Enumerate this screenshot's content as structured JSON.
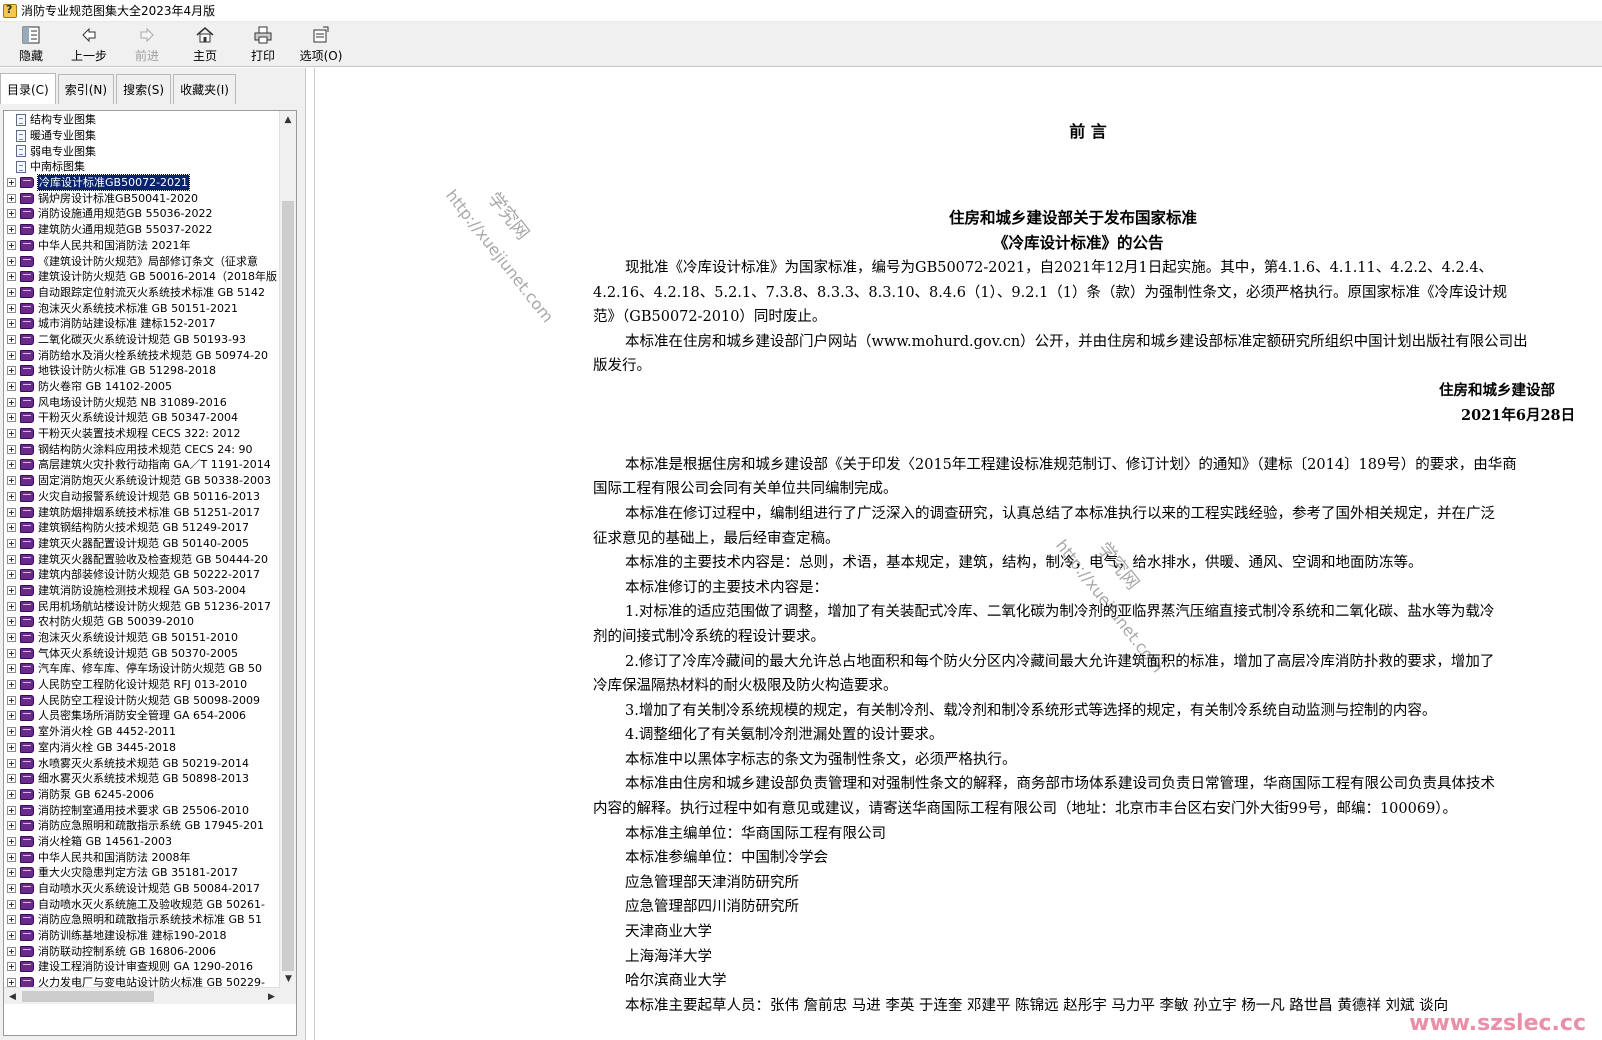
{
  "window": {
    "title": "消防专业规范图集大全2023年4月版"
  },
  "toolbar": {
    "buttons": [
      {
        "label": "隐藏",
        "icon": "hide-pane-icon",
        "enabled": true
      },
      {
        "label": "上一步",
        "icon": "back-arrow-icon",
        "enabled": true
      },
      {
        "label": "前进",
        "icon": "forward-arrow-icon",
        "enabled": false
      },
      {
        "label": "主页",
        "icon": "home-icon",
        "enabled": true
      },
      {
        "label": "打印",
        "icon": "printer-icon",
        "enabled": true
      },
      {
        "label": "选项(O)",
        "icon": "options-icon",
        "enabled": true
      }
    ]
  },
  "tabs": [
    {
      "label": "目录(C)",
      "active": true
    },
    {
      "label": "索引(N)",
      "active": false
    },
    {
      "label": "搜索(S)",
      "active": false
    },
    {
      "label": "收藏夹(I)",
      "active": false
    }
  ],
  "tree": {
    "items": [
      {
        "label": "结构专业图集",
        "type": "page"
      },
      {
        "label": "暖通专业图集",
        "type": "page"
      },
      {
        "label": "弱电专业图集",
        "type": "page"
      },
      {
        "label": "中南标图集",
        "type": "page"
      },
      {
        "label": "冷库设计标准GB50072-2021",
        "type": "book",
        "selected": true
      },
      {
        "label": "锅炉房设计标准GB50041-2020",
        "type": "book"
      },
      {
        "label": "消防设施通用规范GB 55036-2022",
        "type": "book"
      },
      {
        "label": "建筑防火通用规范GB 55037-2022",
        "type": "book"
      },
      {
        "label": "中华人民共和国消防法 2021年",
        "type": "book"
      },
      {
        "label": "《建筑设计防火规范》局部修订条文（征求意",
        "type": "book"
      },
      {
        "label": "建筑设计防火规范 GB 50016-2014（2018年版",
        "type": "book"
      },
      {
        "label": "自动跟踪定位射流灭火系统技术标准 GB 5142",
        "type": "book"
      },
      {
        "label": "泡沫灭火系统技术标准 GB 50151-2021",
        "type": "book"
      },
      {
        "label": "城市消防站建设标准 建标152-2017",
        "type": "book"
      },
      {
        "label": "二氧化碳灭火系统设计规范 GB 50193-93",
        "type": "book"
      },
      {
        "label": "消防给水及消火栓系统技术规范 GB 50974-20",
        "type": "book"
      },
      {
        "label": "地铁设计防火标准 GB 51298-2018",
        "type": "book"
      },
      {
        "label": "防火卷帘 GB 14102-2005",
        "type": "book"
      },
      {
        "label": "风电场设计防火规范 NB 31089-2016",
        "type": "book"
      },
      {
        "label": "干粉灭火系统设计规范 GB 50347-2004",
        "type": "book"
      },
      {
        "label": "干粉灭火装置技术规程 CECS 322: 2012",
        "type": "book"
      },
      {
        "label": "钢结构防火涂料应用技术规范 CECS 24: 90",
        "type": "book"
      },
      {
        "label": "高层建筑火灾扑救行动指南 GA／T 1191-2014",
        "type": "book"
      },
      {
        "label": "固定消防炮灭火系统设计规范 GB 50338-2003",
        "type": "book"
      },
      {
        "label": "火灾自动报警系统设计规范 GB 50116-2013",
        "type": "book"
      },
      {
        "label": "建筑防烟排烟系统技术标准 GB 51251-2017",
        "type": "book"
      },
      {
        "label": "建筑钢结构防火技术规范 GB 51249-2017",
        "type": "book"
      },
      {
        "label": "建筑灭火器配置设计规范 GB 50140-2005",
        "type": "book"
      },
      {
        "label": "建筑灭火器配置验收及检查规范 GB 50444-20",
        "type": "book"
      },
      {
        "label": "建筑内部装修设计防火规范 GB 50222-2017",
        "type": "book"
      },
      {
        "label": "建筑消防设施检测技术规程 GA 503-2004",
        "type": "book"
      },
      {
        "label": "民用机场航站楼设计防火规范 GB 51236-2017",
        "type": "book"
      },
      {
        "label": "农村防火规范 GB 50039-2010",
        "type": "book"
      },
      {
        "label": "泡沫灭火系统设计规范 GB 50151-2010",
        "type": "book"
      },
      {
        "label": "气体灭火系统设计规范 GB 50370-2005",
        "type": "book"
      },
      {
        "label": "汽车库、修车库、停车场设计防火规范 GB 50",
        "type": "book"
      },
      {
        "label": "人民防空工程防化设计规范 RFJ 013-2010",
        "type": "book"
      },
      {
        "label": "人民防空工程设计防火规范 GB 50098-2009",
        "type": "book"
      },
      {
        "label": "人员密集场所消防安全管理 GA 654-2006",
        "type": "book"
      },
      {
        "label": "室外消火栓 GB 4452-2011",
        "type": "book"
      },
      {
        "label": "室内消火栓 GB 3445-2018",
        "type": "book"
      },
      {
        "label": "水喷雾灭火系统技术规范 GB 50219-2014",
        "type": "book"
      },
      {
        "label": "细水雾灭火系统技术规范 GB 50898-2013",
        "type": "book"
      },
      {
        "label": "消防泵 GB 6245-2006",
        "type": "book"
      },
      {
        "label": "消防控制室通用技术要求 GB 25506-2010",
        "type": "book"
      },
      {
        "label": "消防应急照明和疏散指示系统 GB 17945-201",
        "type": "book"
      },
      {
        "label": "消火栓箱 GB 14561-2003",
        "type": "book"
      },
      {
        "label": "中华人民共和国消防法 2008年",
        "type": "book"
      },
      {
        "label": "重大火灾隐患判定方法 GB 35181-2017",
        "type": "book"
      },
      {
        "label": "自动喷水灭火系统设计规范 GB 50084-2017",
        "type": "book"
      },
      {
        "label": "自动喷水灭火系统施工及验收规范 GB 50261-",
        "type": "book"
      },
      {
        "label": "消防应急照明和疏散指示系统技术标准 GB 51",
        "type": "book"
      },
      {
        "label": "消防训练基地建设标准 建标190-2018",
        "type": "book"
      },
      {
        "label": "消防联动控制系统 GB 16806-2006",
        "type": "book"
      },
      {
        "label": "建设工程消防设计审查规则 GA 1290-2016",
        "type": "book"
      },
      {
        "label": "火力发电厂与变电站设计防火标准 GB 50229-",
        "type": "book"
      }
    ]
  },
  "document": {
    "preface_title": "前 言",
    "heading_line1": "住房和城乡建设部关于发布国家标准",
    "heading_line2": "《冷库设计标准》的公告",
    "lines": [
      {
        "text": "现批准《冷库设计标准》为国家标准，编号为GB50072-2021，自2021年12月1日起实施。其中，第4.1.6、4.1.11、4.2.2、4.2.4、",
        "style": "ind"
      },
      {
        "text": "4.2.16、4.2.18、5.2.1、7.3.8、8.3.3、8.3.10、8.4.6（1）、9.2.1（1）条（款）为强制性条文，必须严格执行。原国家标准《冷库设计规",
        "style": ""
      },
      {
        "text": "范》（GB50072-2010）同时废止。",
        "style": ""
      },
      {
        "text": "本标准在住房和城乡建设部门户网站（www.mohurd.gov.cn）公开，并由住房和城乡建设部标准定额研究所组织中国计划出版社有限公司出",
        "style": "ind"
      },
      {
        "text": "版发行。",
        "style": ""
      },
      {
        "text": "住房和城乡建设部",
        "style": "right"
      },
      {
        "text": "2021年6月28日",
        "style": "right2"
      },
      {
        "text": "",
        "style": "blank"
      },
      {
        "text": "本标准是根据住房和城乡建设部《关于印发〈2015年工程建设标准规范制订、修订计划〉的通知》（建标〔2014〕189号）的要求，由华商",
        "style": "ind"
      },
      {
        "text": "国际工程有限公司会同有关单位共同编制完成。",
        "style": ""
      },
      {
        "text": "本标准在修订过程中，编制组进行了广泛深入的调查研究，认真总结了本标准执行以来的工程实践经验，参考了国外相关规定，并在广泛",
        "style": "ind"
      },
      {
        "text": "征求意见的基础上，最后经审查定稿。",
        "style": ""
      },
      {
        "text": "本标准的主要技术内容是：总则，术语，基本规定，建筑，结构，制冷，电气，给水排水，供暖、通风、空调和地面防冻等。",
        "style": "ind"
      },
      {
        "text": "本标准修订的主要技术内容是：",
        "style": "ind"
      },
      {
        "text": "1.对标准的适应范围做了调整，增加了有关装配式冷库、二氧化碳为制冷剂的亚临界蒸汽压缩直接式制冷系统和二氧化碳、盐水等为载冷",
        "style": "ind"
      },
      {
        "text": "剂的间接式制冷系统的程设计要求。",
        "style": ""
      },
      {
        "text": "2.修订了冷库冷藏间的最大允许总占地面积和每个防火分区内冷藏间最大允许建筑面积的标准，增加了高层冷库消防扑救的要求，增加了",
        "style": "ind"
      },
      {
        "text": "冷库保温隔热材料的耐火极限及防火构造要求。",
        "style": ""
      },
      {
        "text": "3.增加了有关制冷系统规模的规定，有关制冷剂、载冷剂和制冷系统形式等选择的规定，有关制冷系统自动监测与控制的内容。",
        "style": "ind"
      },
      {
        "text": "4.调整细化了有关氨制冷剂泄漏处置的设计要求。",
        "style": "ind"
      },
      {
        "text": "本标准中以黑体字标志的条文为强制性条文，必须严格执行。",
        "style": "ind"
      },
      {
        "text": "本标准由住房和城乡建设部负责管理和对强制性条文的解释，商务部市场体系建设司负责日常管理，华商国际工程有限公司负责具体技术",
        "style": "ind"
      },
      {
        "text": "内容的解释。执行过程中如有意见或建议，请寄送华商国际工程有限公司（地址：北京市丰台区右安门外大街99号，邮编：100069）。",
        "style": ""
      },
      {
        "text": "本标准主编单位：华商国际工程有限公司",
        "style": "ind"
      },
      {
        "text": "本标准参编单位：中国制冷学会",
        "style": "ind"
      },
      {
        "text": "应急管理部天津消防研究所",
        "style": "ind"
      },
      {
        "text": "应急管理部四川消防研究所",
        "style": "ind"
      },
      {
        "text": "天津商业大学",
        "style": "ind"
      },
      {
        "text": "上海海洋大学",
        "style": "ind"
      },
      {
        "text": "哈尔滨商业大学",
        "style": "ind"
      },
      {
        "text": "本标准主要起草人员：张伟 詹前忠 马进 李英 于连奎 邓建平 陈锦远 赵彤宇 马力平 李敏 孙立宇 杨一凡 路世昌 黄德祥 刘斌 谈向",
        "style": "ind"
      }
    ]
  },
  "watermarks": {
    "site_name": "学究网",
    "site_url": "http://xuejiunet.com",
    "corner_url": "www.szslec.cc"
  }
}
